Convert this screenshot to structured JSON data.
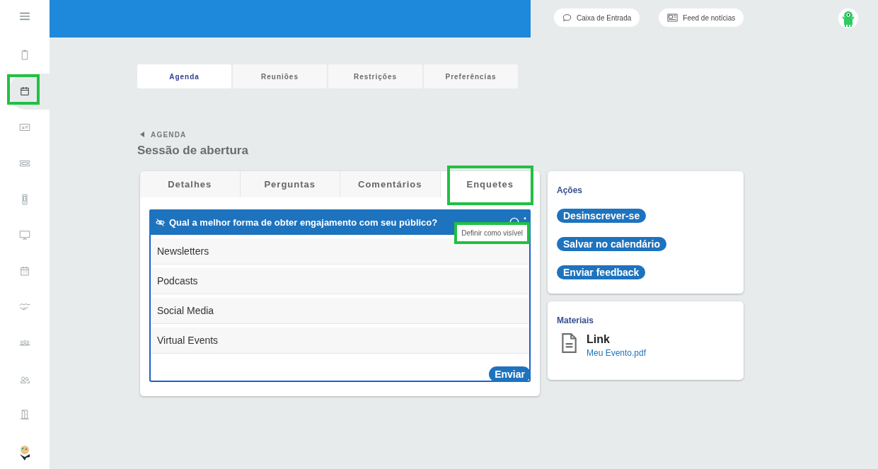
{
  "sidebar": {
    "items": [
      {
        "selected": false
      },
      {
        "selected": true
      },
      {
        "selected": false
      },
      {
        "selected": false
      },
      {
        "selected": false
      },
      {
        "selected": false
      },
      {
        "selected": false
      },
      {
        "selected": false
      },
      {
        "selected": false
      },
      {
        "selected": false
      },
      {
        "selected": false
      }
    ]
  },
  "top_bar": {
    "buttons": [
      {
        "label": "Caixa de Entrada"
      },
      {
        "label": "Feed de notícias"
      }
    ]
  },
  "nav_tabs": [
    {
      "label": "Agenda",
      "selected": true
    },
    {
      "label": "Reuniões",
      "selected": false
    },
    {
      "label": "Restrições",
      "selected": false
    },
    {
      "label": "Preferências",
      "selected": false
    }
  ],
  "breadcrumb": "AGENDA",
  "title": "Sessão de abertura",
  "session_tabs": [
    {
      "label": "Detalhes",
      "selected": false
    },
    {
      "label": "Perguntas",
      "selected": false
    },
    {
      "label": "Comentários",
      "selected": false
    },
    {
      "label": "Enquetes",
      "selected": true
    }
  ],
  "poll": {
    "question": "Qual a melhor forma de obter engajamento com seu público?",
    "tooltip": "Definir como visível",
    "options": [
      "Newsletters",
      "Podcasts",
      "Social Media",
      "Virtual Events"
    ],
    "submit": "Enviar"
  },
  "actions": {
    "title": "Ações",
    "buttons": [
      "Desinscrever-se",
      "Salvar no calendário",
      "Enviar feedback"
    ]
  },
  "materials": {
    "title": "Materiais",
    "items": [
      {
        "title": "Link",
        "file": "Meu Evento.pdf"
      }
    ]
  }
}
